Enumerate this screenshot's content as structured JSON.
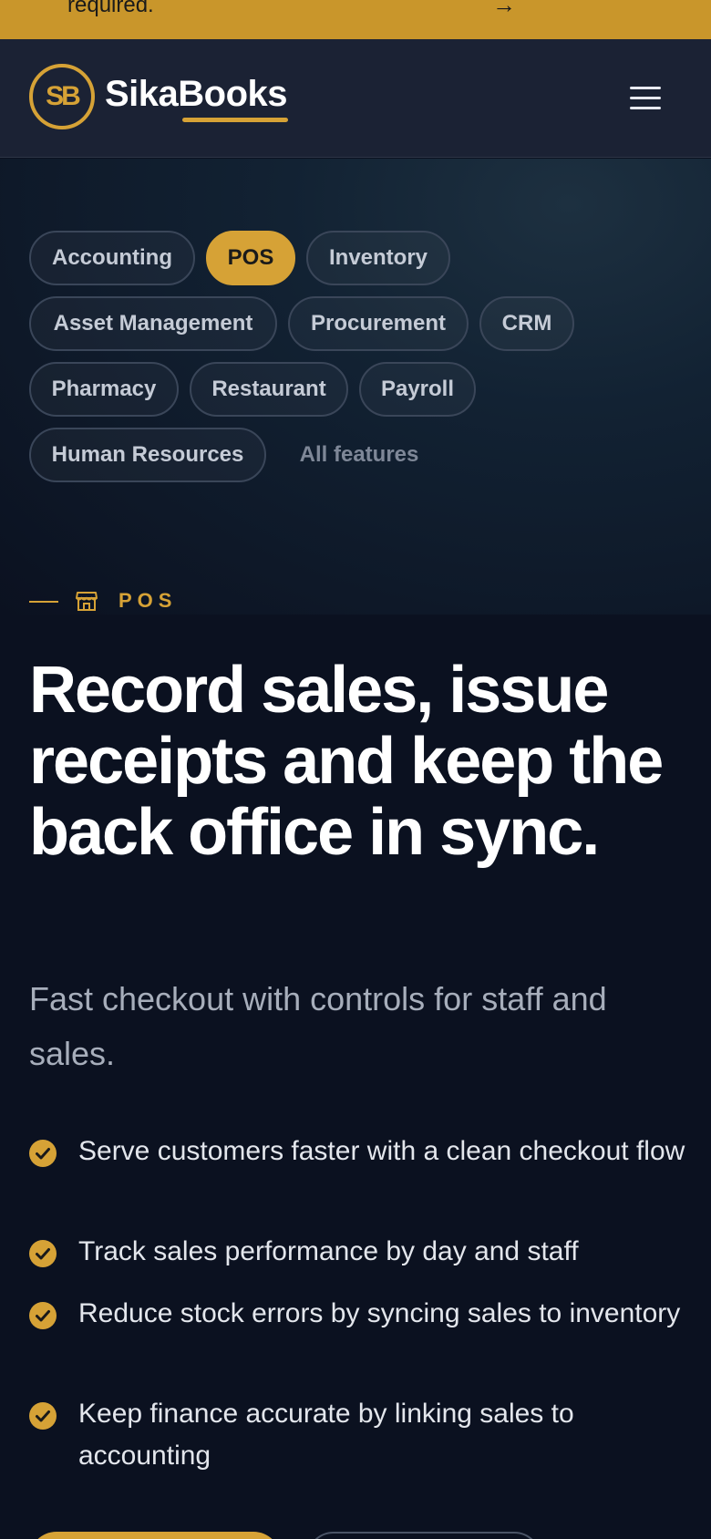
{
  "banner": {
    "text": "required.",
    "arrow": "→"
  },
  "brand": {
    "mark": "SB",
    "name": "SikaBooks"
  },
  "nav": {
    "menu_icon": "hamburger-menu-icon"
  },
  "modules": [
    {
      "label": "Accounting",
      "active": false
    },
    {
      "label": "POS",
      "active": true
    },
    {
      "label": "Inventory",
      "active": false
    },
    {
      "label": "Asset Management",
      "active": false
    },
    {
      "label": "Procurement",
      "active": false
    },
    {
      "label": "CRM",
      "active": false
    },
    {
      "label": "Pharmacy",
      "active": false
    },
    {
      "label": "Restaurant",
      "active": false
    },
    {
      "label": "Payroll",
      "active": false
    },
    {
      "label": "Human Resources",
      "active": false
    }
  ],
  "all_features_label": "All features",
  "section": {
    "eyebrow": "POS",
    "eyebrow_icon": "storefront-icon",
    "headline": "Record sales, issue receipts and keep the back office in sync.",
    "subtitle": "Fast checkout with controls for staff and sales."
  },
  "benefits": [
    "Serve customers faster with a clean checkout flow",
    "Track sales performance by day and staff",
    "Reduce stock errors by syncing sales to inventory",
    "Keep finance accurate by linking sales to accounting"
  ],
  "colors": {
    "accent": "#d6a236",
    "banner": "#c9962b",
    "navbar": "#1b2234",
    "background": "#0b1120"
  }
}
